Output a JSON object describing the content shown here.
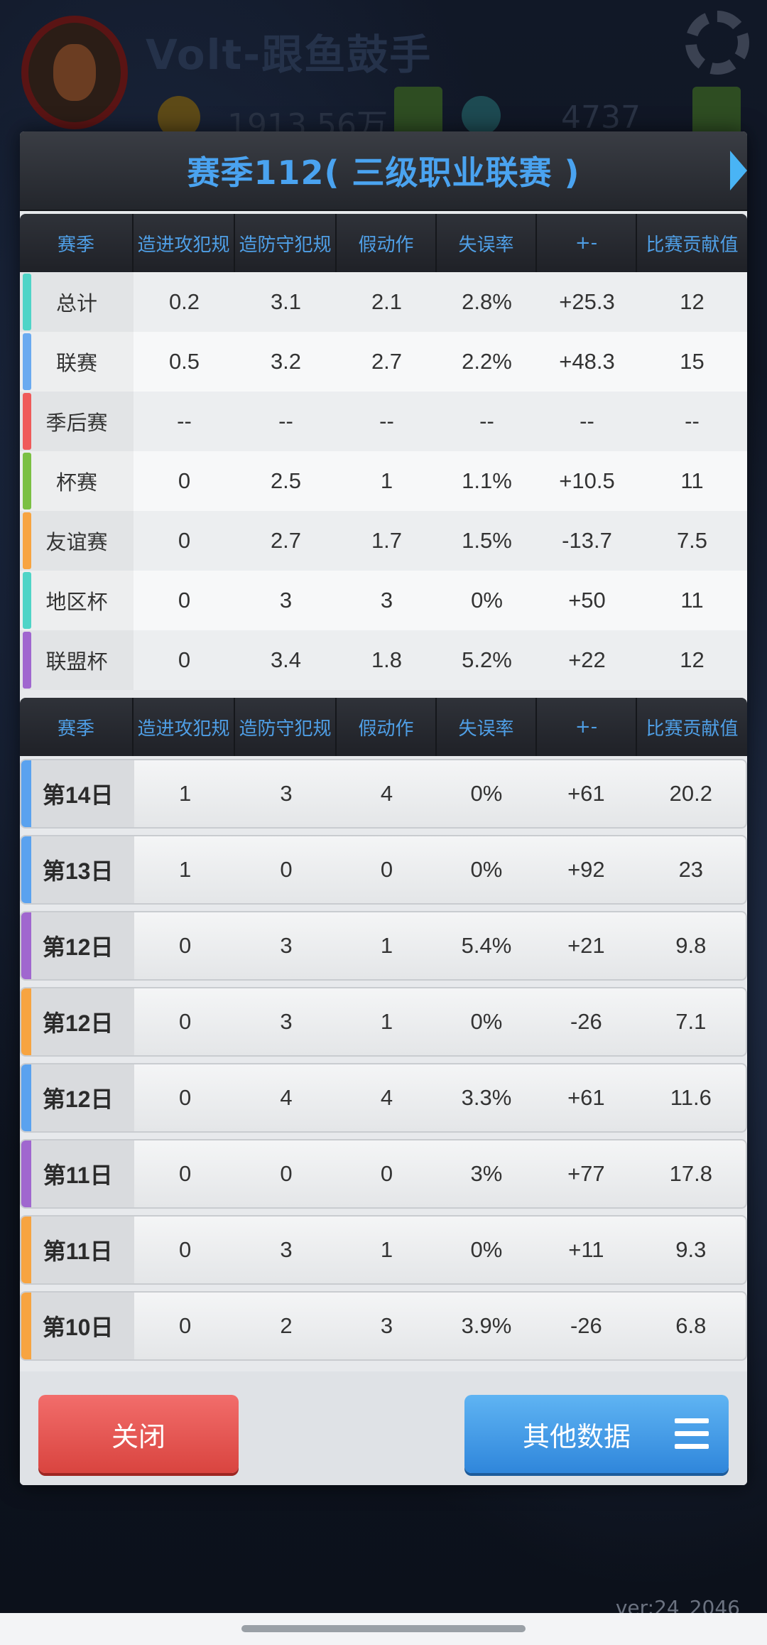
{
  "background": {
    "team_name": "Volt-跟鱼鼓手",
    "coins": "1913.56万",
    "gems": "4737"
  },
  "dialog": {
    "title": "赛季112( 三级职业联赛 )",
    "headers": [
      "赛季",
      "造进攻犯规",
      "造防守犯规",
      "假动作",
      "失误率",
      "+-",
      "比赛贡献值"
    ],
    "summary_rows": [
      {
        "label": "总计",
        "color": "#4fd4c7",
        "values": [
          "0.2",
          "3.1",
          "2.1",
          "2.8%",
          "+25.3",
          "12"
        ]
      },
      {
        "label": "联赛",
        "color": "#6aaaf0",
        "values": [
          "0.5",
          "3.2",
          "2.7",
          "2.2%",
          "+48.3",
          "15"
        ]
      },
      {
        "label": "季后赛",
        "color": "#ef5a5a",
        "values": [
          "--",
          "--",
          "--",
          "--",
          "--",
          "--"
        ]
      },
      {
        "label": "杯赛",
        "color": "#7bc043",
        "values": [
          "0",
          "2.5",
          "1",
          "1.1%",
          "+10.5",
          "11"
        ]
      },
      {
        "label": "友谊赛",
        "color": "#f7a441",
        "values": [
          "0",
          "2.7",
          "1.7",
          "1.5%",
          "-13.7",
          "7.5"
        ]
      },
      {
        "label": "地区杯",
        "color": "#4fd4c7",
        "values": [
          "0",
          "3",
          "3",
          "0%",
          "+50",
          "11"
        ]
      },
      {
        "label": "联盟杯",
        "color": "#a067cf",
        "values": [
          "0",
          "3.4",
          "1.8",
          "5.2%",
          "+22",
          "12"
        ]
      }
    ],
    "game_rows": [
      {
        "label": "第14日",
        "color": "#5aa2ef",
        "values": [
          "1",
          "3",
          "4",
          "0%",
          "+61",
          "20.2"
        ]
      },
      {
        "label": "第13日",
        "color": "#5aa2ef",
        "values": [
          "1",
          "0",
          "0",
          "0%",
          "+92",
          "23"
        ]
      },
      {
        "label": "第12日",
        "color": "#a067cf",
        "values": [
          "0",
          "3",
          "1",
          "5.4%",
          "+21",
          "9.8"
        ]
      },
      {
        "label": "第12日",
        "color": "#f7a441",
        "values": [
          "0",
          "3",
          "1",
          "0%",
          "-26",
          "7.1"
        ]
      },
      {
        "label": "第12日",
        "color": "#5aa2ef",
        "values": [
          "0",
          "4",
          "4",
          "3.3%",
          "+61",
          "11.6"
        ]
      },
      {
        "label": "第11日",
        "color": "#a067cf",
        "values": [
          "0",
          "0",
          "0",
          "3%",
          "+77",
          "17.8"
        ]
      },
      {
        "label": "第11日",
        "color": "#f7a441",
        "values": [
          "0",
          "3",
          "1",
          "0%",
          "+11",
          "9.3"
        ]
      },
      {
        "label": "第10日",
        "color": "#f7a441",
        "values": [
          "0",
          "2",
          "3",
          "3.9%",
          "-26",
          "6.8"
        ]
      }
    ],
    "close_label": "关闭",
    "other_label": "其他数据"
  },
  "version": "ver:24_2046",
  "icons": [
    "gear-icon",
    "next-arrow-icon",
    "menu-icon",
    "coin-icon",
    "gem-icon"
  ]
}
